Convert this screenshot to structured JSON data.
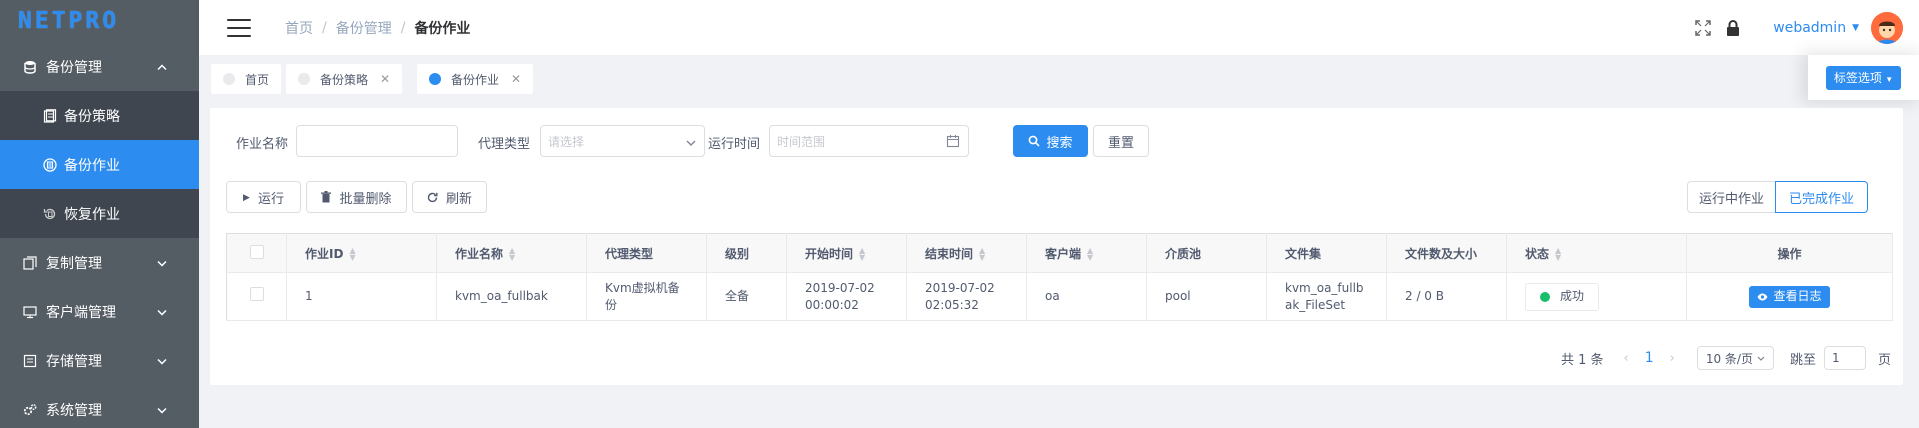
{
  "app": {
    "logo_text": "NETPRO"
  },
  "sidebar": {
    "groups": [
      {
        "label": "备份管理",
        "expanded": true,
        "items": [
          {
            "label": "备份策略",
            "active": false
          },
          {
            "label": "备份作业",
            "active": true
          },
          {
            "label": "恢复作业",
            "active": false
          }
        ]
      },
      {
        "label": "复制管理"
      },
      {
        "label": "客户端管理"
      },
      {
        "label": "存储管理"
      },
      {
        "label": "系统管理"
      }
    ]
  },
  "header": {
    "breadcrumbs": [
      "首页",
      "备份管理",
      "备份作业"
    ],
    "username": "webadmin"
  },
  "tags": {
    "items": [
      {
        "label": "首页",
        "closable": false,
        "active": false
      },
      {
        "label": "备份策略",
        "closable": true,
        "active": false
      },
      {
        "label": "备份作业",
        "closable": true,
        "active": true
      }
    ],
    "options_label": "标签选项"
  },
  "search": {
    "job_name_label": "作业名称",
    "job_name_value": "",
    "agent_type_label": "代理类型",
    "agent_type_placeholder": "请选择",
    "run_time_label": "运行时间",
    "run_time_placeholder": "时间范围",
    "search_button": "搜索",
    "reset_button": "重置"
  },
  "toolbar": {
    "run_button": "运行",
    "batch_delete_button": "批量删除",
    "refresh_button": "刷新",
    "running_jobs_tab": "运行中作业",
    "completed_jobs_tab": "已完成作业"
  },
  "table": {
    "columns": [
      "作业ID",
      "作业名称",
      "代理类型",
      "级别",
      "开始时间",
      "结束时间",
      "客户端",
      "介质池",
      "文件集",
      "文件数及大小",
      "状态",
      "操作"
    ],
    "rows": [
      {
        "id": "1",
        "name": "kvm_oa_fullbak",
        "agent_type": "Kvm虚拟机备份",
        "level": "全备",
        "start_time": "2019-07-02 00:00:02",
        "end_time": "2019-07-02 02:05:32",
        "client": "oa",
        "pool": "pool",
        "fileset": "kvm_oa_fullbak_FileSet",
        "files_size": "2 / 0 B",
        "status": "成功",
        "action": "查看日志"
      }
    ]
  },
  "pagination": {
    "total_text": "共 1 条",
    "current_page": "1",
    "page_size": "10 条/页",
    "goto_label": "跳至",
    "goto_value": "1",
    "page_suffix": "页"
  },
  "colors": {
    "primary": "#2d8cf0",
    "sidebar": "#545c64",
    "success": "#19be6b"
  }
}
